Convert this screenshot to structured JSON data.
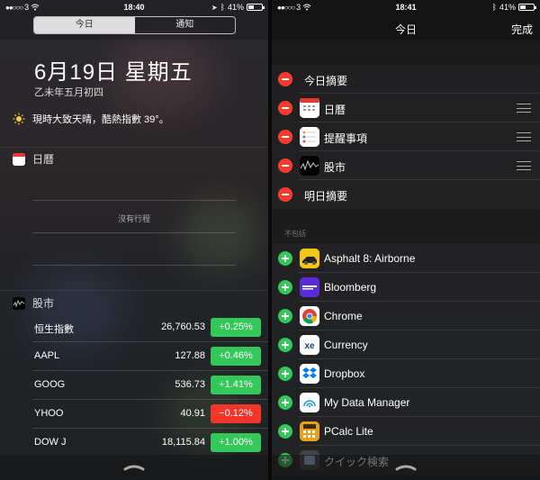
{
  "left": {
    "status": {
      "carrier": "3",
      "time": "18:40",
      "battery": "41%"
    },
    "tabs": [
      {
        "label": "今日",
        "active": true
      },
      {
        "label": "通知",
        "active": false
      }
    ],
    "date": "6月19日 星期五",
    "lunar": "乙未年五月初四",
    "weather": "現時大致天晴，酷熱指數 39°。",
    "calendar": {
      "title": "日曆",
      "empty": "沒有行程"
    },
    "stocks": {
      "title": "股市",
      "rows": [
        {
          "name": "恒生指數",
          "price": "26,760.53",
          "change": "+0.25%",
          "dir": "up"
        },
        {
          "name": "AAPL",
          "price": "127.88",
          "change": "+0.46%",
          "dir": "up"
        },
        {
          "name": "GOOG",
          "price": "536.73",
          "change": "+1.41%",
          "dir": "up"
        },
        {
          "name": "YHOO",
          "price": "40.91",
          "change": "−0.12%",
          "dir": "down"
        },
        {
          "name": "DOW J",
          "price": "18,115.84",
          "change": "+1.00%",
          "dir": "up"
        }
      ]
    }
  },
  "right": {
    "status": {
      "carrier": "3",
      "time": "18:41",
      "battery": "41%"
    },
    "title": "今日",
    "done": "完成",
    "enabled": [
      {
        "label": "今日摘要",
        "icon": null,
        "handle": false
      },
      {
        "label": "日曆",
        "icon": "calendar-app-icon",
        "handle": true
      },
      {
        "label": "提醒事項",
        "icon": "reminders-app-icon",
        "handle": true
      },
      {
        "label": "股市",
        "icon": "stocks-app-icon",
        "handle": true
      },
      {
        "label": "明日摘要",
        "icon": null,
        "handle": false
      }
    ],
    "section_label": "不包括",
    "available": [
      {
        "label": "Asphalt 8: Airborne",
        "icon": "asphalt-app-icon",
        "color": "#f5c518"
      },
      {
        "label": "Bloomberg",
        "icon": "bloomberg-app-icon",
        "color": "#5b2bd8"
      },
      {
        "label": "Chrome",
        "icon": "chrome-app-icon",
        "color": "#ffffff"
      },
      {
        "label": "Currency",
        "icon": "currency-app-icon",
        "color": "#ffffff"
      },
      {
        "label": "Dropbox",
        "icon": "dropbox-app-icon",
        "color": "#ffffff"
      },
      {
        "label": "My Data Manager",
        "icon": "mydatamanager-app-icon",
        "color": "#ffffff"
      },
      {
        "label": "PCalc Lite",
        "icon": "pcalc-app-icon",
        "color": "#e8a020"
      },
      {
        "label": "クイック検索",
        "icon": "quicksearch-app-icon",
        "color": "#444444"
      }
    ]
  }
}
